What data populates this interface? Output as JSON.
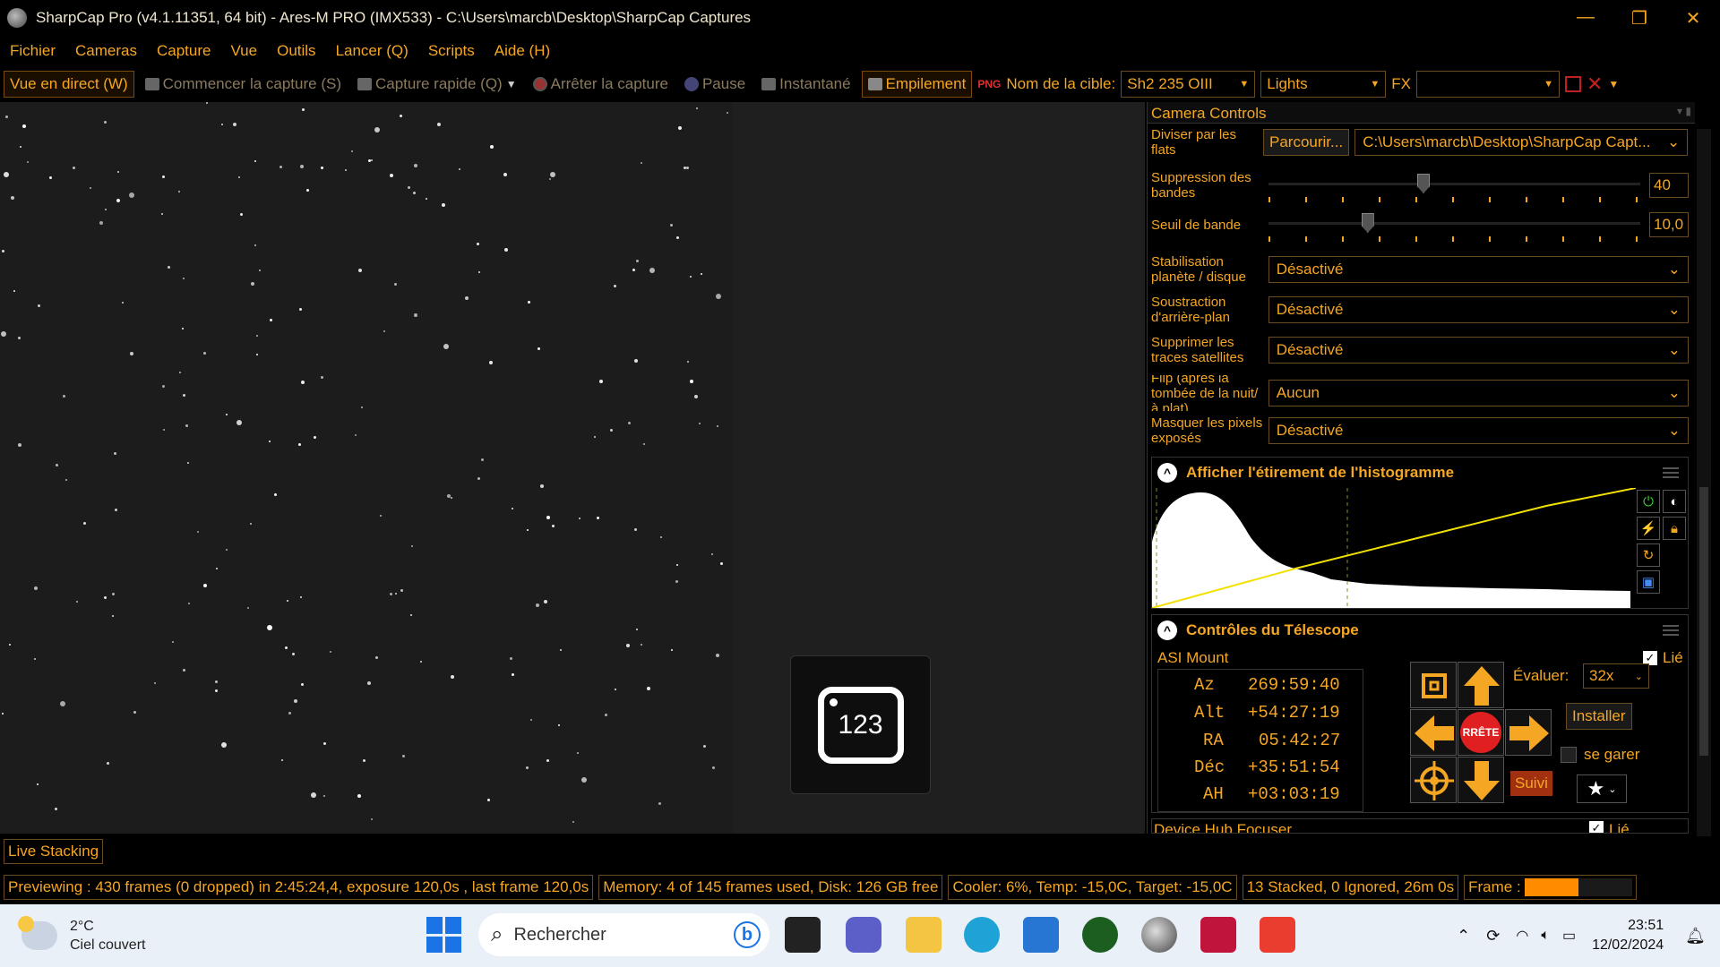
{
  "titlebar": {
    "title": "SharpCap Pro (v4.1.11351, 64 bit) - Ares-M PRO (IMX533) - C:\\Users\\marcb\\Desktop\\SharpCap Captures",
    "minimize": "—",
    "restore": "❐",
    "close": "✕"
  },
  "menu": [
    "Fichier",
    "Cameras",
    "Capture",
    "Vue",
    "Outils",
    "Lancer (Q)",
    "Scripts",
    "Aide (H)"
  ],
  "toolbar": {
    "live": "Vue en direct (W)",
    "start": "Commencer la capture (S)",
    "quick": "Capture rapide (Q)",
    "stop": "Arrêter la capture",
    "pause": "Pause",
    "snapshot": "Instantané",
    "stack": "Empilement",
    "target_label": "Nom de la cible:",
    "target_value": "Sh2 235 OIII",
    "frame_type": "Lights",
    "fx": "FX",
    "fx_value": ""
  },
  "badge": {
    "text": "123"
  },
  "panel": {
    "title": "Camera Controls",
    "flat": {
      "label": "Diviser par les flats",
      "button": "Parcourir...",
      "path": "C:\\Users\\marcb\\Desktop\\SharpCap Capt..."
    },
    "banding": {
      "label": "Suppression des bandes",
      "value": "40",
      "fraction": 0.4
    },
    "threshold": {
      "label": "Seuil de bande",
      "value": "10,0",
      "fraction": 0.25
    },
    "dropdowns": [
      {
        "label": "Stabilisation planète / disque",
        "value": "Désactivé"
      },
      {
        "label": "Soustraction d'arrière-plan",
        "value": "Désactivé"
      },
      {
        "label": "Supprimer les traces satellites",
        "value": "Désactivé"
      },
      {
        "label": "Flip (après la tombée de la nuit/à plat)",
        "value": "Aucun"
      },
      {
        "label": "Masquer les pixels exposés",
        "value": "Désactivé"
      }
    ],
    "histogram": {
      "title": "Afficher l'étirement de l'histogramme"
    },
    "telescope": {
      "title": "Contrôles du Télescope",
      "mount": "ASI Mount",
      "linked": "Lié",
      "coords": [
        {
          "k": "Az",
          "v": "269:59:40"
        },
        {
          "k": "Alt",
          "v": "+54:27:19"
        },
        {
          "k": "RA",
          "v": "05:42:27"
        },
        {
          "k": "Déc",
          "v": "+35:51:54"
        },
        {
          "k": "AH",
          "v": "+03:03:19"
        }
      ],
      "rate_label": "Évaluer:",
      "rate": "32x",
      "install": "Installer",
      "park": "se garer",
      "track": "Suivi",
      "stop": "RRÊTE"
    },
    "focuser": {
      "title": "Device Hub Focuser",
      "linked": "Lié"
    }
  },
  "live_stacking": "Live Stacking",
  "status": {
    "preview": "Previewing : 430 frames (0 dropped) in 2:45:24,4, exposure 120,0s , last frame 120,0s",
    "memory": "Memory: 4 of 145 frames used, Disk: 126 GB free",
    "cooler": "Cooler: 6%, Temp: -15,0C, Target: -15,0C",
    "stacked": "13 Stacked, 0 Ignored, 26m 0s",
    "frame_label": "Frame :",
    "frame_fraction": 0.5
  },
  "taskbar": {
    "temp": "2°C",
    "weather": "Ciel couvert",
    "search": "Rechercher",
    "time": "23:51",
    "date": "12/02/2024"
  },
  "colors": {
    "accent": "#f5a623",
    "background": "#000000"
  }
}
